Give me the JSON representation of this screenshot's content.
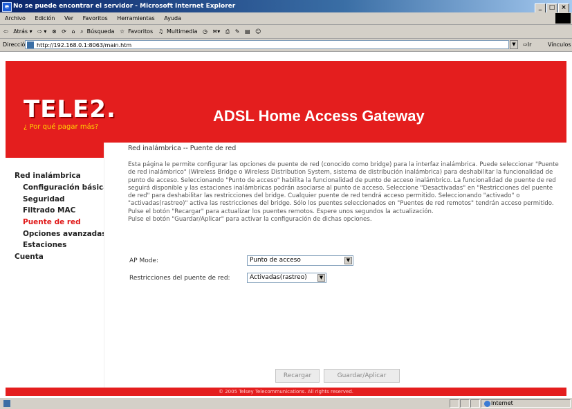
{
  "window": {
    "title": "No se puede encontrar el servidor - Microsoft Internet Explorer",
    "controls": [
      "_",
      "□",
      "×"
    ]
  },
  "menu": [
    "Archivo",
    "Edición",
    "Ver",
    "Favoritos",
    "Herramientas",
    "Ayuda"
  ],
  "toolbar": {
    "back": "Atrás",
    "search": "Búsqueda",
    "favorites": "Favoritos",
    "multimedia": "Multimedia"
  },
  "address": {
    "label": "Dirección",
    "url": "http://192.168.0.1:8063/main.htm",
    "go": "Ir",
    "links": "Vínculos"
  },
  "header": {
    "brand": "TELE2.",
    "slogan": "¿ Por qué pagar más?",
    "title": "ADSL Home Access Gateway"
  },
  "sidebar": {
    "section": "Red inalámbrica",
    "items": [
      "Configuración básica",
      "Seguridad",
      "Filtrado MAC",
      "Puente de red",
      "Opciones avanzadas",
      "Estaciones"
    ],
    "account": "Cuenta",
    "active_color": "#e01818"
  },
  "main": {
    "title": "Red inalámbrica -- Puente de red",
    "paragraph1": "Esta página le permite configurar las opciones de puente de red (conocido como bridge) para la interfaz inalámbrica. Puede seleccionar \"Puente de red inalámbrico\" (Wireless Bridge o Wireless Distribution System, sistema de distribución inalámbrica) para deshabilitar la funcionalidad de punto de acceso. Seleccionando \"Punto de acceso\" habilita la funcionalidad de punto de acceso inalámbrico. La funcionalidad de puente de red seguirá disponible y las estaciones inalámbricas podrán asociarse al punto de acceso. Seleccione \"Desactivadas\" en \"Restricciones del puente de red\" para deshabilitar las restricciones del bridge. Cualquier puente de red tendrá acceso permitido. Seleccionando \"activado\" o \"activadas(rastreo)\" activa las restricciones del bridge. Sólo los puentes seleccionados en \"Puentes de red remotos\" tendrán acceso permitido.",
    "paragraph2": "Pulse el botón \"Recargar\" para actualizar los puentes remotos. Espere unos segundos la actualización.",
    "paragraph3": "Pulse el botón \"Guardar/Aplicar\" para activar la configuración de dichas opciones.",
    "ap_mode": {
      "label": "AP Mode:",
      "value": "Punto de acceso"
    },
    "restrictions": {
      "label": "Restricciones del puente de red:",
      "value": "Activadas(rastreo)"
    },
    "buttons": {
      "reload": "Recargar",
      "apply": "Guardar/Aplicar"
    }
  },
  "footer": "© 2005 Telsey Telecommunications. All rights reserved.",
  "status": {
    "zone": "Internet"
  },
  "colors": {
    "brand_red": "#e41e1e",
    "slogan_yellow": "#ffd400"
  }
}
